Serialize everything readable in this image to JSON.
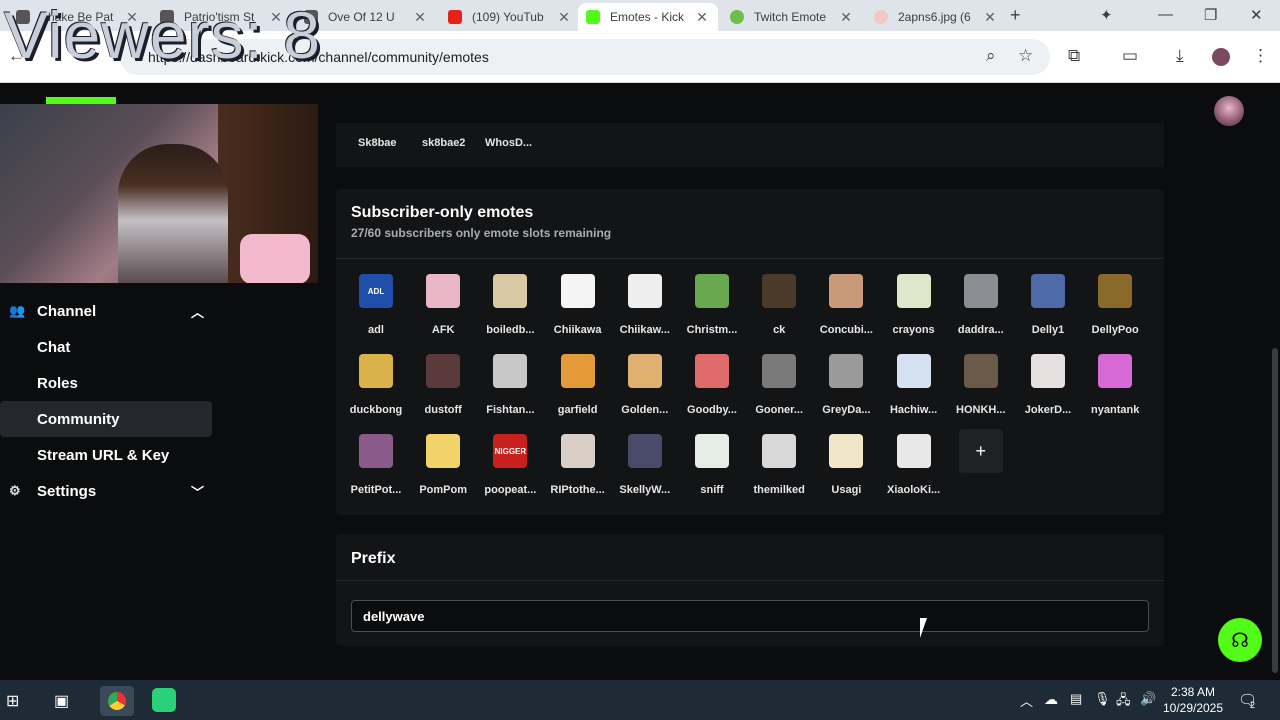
{
  "overlay": {
    "viewers": "Viewers: 8"
  },
  "browser": {
    "tabs": [
      {
        "title": "Shake Be Pat",
        "icon": "kick-icon"
      },
      {
        "title": "Patrio'tism St",
        "icon": "kick-icon"
      },
      {
        "title": "Ove Of 12 U",
        "icon": "kick-icon"
      },
      {
        "title": "(109) YouTub",
        "icon": "youtube-icon"
      },
      {
        "title": "Emotes - Kick",
        "icon": "kick-icon"
      },
      {
        "title": "Twitch Emote",
        "icon": "frog-icon"
      },
      {
        "title": "2apns6.jpg (6",
        "icon": "image-icon"
      }
    ],
    "url": "https://dashboard.kick.com/channel/community/emotes"
  },
  "badges_row": [
    "Sk8bae",
    "sk8bae2",
    "WhosD..."
  ],
  "subscriber": {
    "title": "Subscriber-only emotes",
    "subtitle": "27/60 subscribers only emote slots remaining",
    "emotes": [
      {
        "name": "adl",
        "color": "#1f4fa8",
        "glyph": "ADL"
      },
      {
        "name": "AFK",
        "color": "#e9b7c5",
        "glyph": ""
      },
      {
        "name": "boiledb...",
        "color": "#d8c9a4",
        "glyph": ""
      },
      {
        "name": "Chiikawa",
        "color": "#f4f4f4",
        "glyph": ""
      },
      {
        "name": "Chiikaw...",
        "color": "#eeeeee",
        "glyph": ""
      },
      {
        "name": "Christm...",
        "color": "#6aa84f",
        "glyph": ""
      },
      {
        "name": "ck",
        "color": "#4a3a2a",
        "glyph": ""
      },
      {
        "name": "Concubi...",
        "color": "#c89a7a",
        "glyph": ""
      },
      {
        "name": "crayons",
        "color": "#dfe6c9",
        "glyph": ""
      },
      {
        "name": "daddra...",
        "color": "#8a8d92",
        "glyph": ""
      },
      {
        "name": "Delly1",
        "color": "#4f6aa8",
        "glyph": ""
      },
      {
        "name": "DellyPoo",
        "color": "#8a6a2a",
        "glyph": ""
      },
      {
        "name": "duckbong",
        "color": "#d9b24a",
        "glyph": ""
      },
      {
        "name": "dustoff",
        "color": "#5a3a3a",
        "glyph": ""
      },
      {
        "name": "Fishtan...",
        "color": "#c8c8c8",
        "glyph": ""
      },
      {
        "name": "garfield",
        "color": "#e59a3a",
        "glyph": ""
      },
      {
        "name": "Golden...",
        "color": "#e0b070",
        "glyph": ""
      },
      {
        "name": "Goodby...",
        "color": "#e06b6b",
        "glyph": ""
      },
      {
        "name": "Gooner...",
        "color": "#7a7a7a",
        "glyph": ""
      },
      {
        "name": "GreyDa...",
        "color": "#9a9a9a",
        "glyph": ""
      },
      {
        "name": "Hachiw...",
        "color": "#d6e2f2",
        "glyph": ""
      },
      {
        "name": "HONKH...",
        "color": "#6a5a4a",
        "glyph": ""
      },
      {
        "name": "JokerD...",
        "color": "#e8e0e0",
        "glyph": ""
      },
      {
        "name": "nyantank",
        "color": "#d86ad8",
        "glyph": ""
      },
      {
        "name": "PetitPot...",
        "color": "#8a5a8a",
        "glyph": ""
      },
      {
        "name": "PomPom",
        "color": "#f2d36a",
        "glyph": ""
      },
      {
        "name": "poopeat...",
        "color": "#c8201e",
        "glyph": "NIGGER"
      },
      {
        "name": "RIPtothe...",
        "color": "#d9cfc8",
        "glyph": ""
      },
      {
        "name": "SkellyW...",
        "color": "#4a4a6a",
        "glyph": ""
      },
      {
        "name": "sniff",
        "color": "#e6ece6",
        "glyph": ""
      },
      {
        "name": "themilked",
        "color": "#d8d8d8",
        "glyph": ""
      },
      {
        "name": "Usagi",
        "color": "#f2e6c8",
        "glyph": ""
      },
      {
        "name": "XiaoloKi...",
        "color": "#e8e8e8",
        "glyph": ""
      }
    ],
    "add_label": "+"
  },
  "prefix": {
    "title": "Prefix",
    "value": "dellywave"
  },
  "sidebar": {
    "items": [
      {
        "label": "Channel",
        "icon": "people-icon"
      },
      {
        "label": "Chat"
      },
      {
        "label": "Roles"
      },
      {
        "label": "Community"
      },
      {
        "label": "Stream URL & Key"
      },
      {
        "label": "Settings",
        "icon": "gear-icon"
      }
    ]
  },
  "taskbar": {
    "time": "2:38 AM",
    "date": "10/29/2025",
    "notif_count": "2"
  }
}
